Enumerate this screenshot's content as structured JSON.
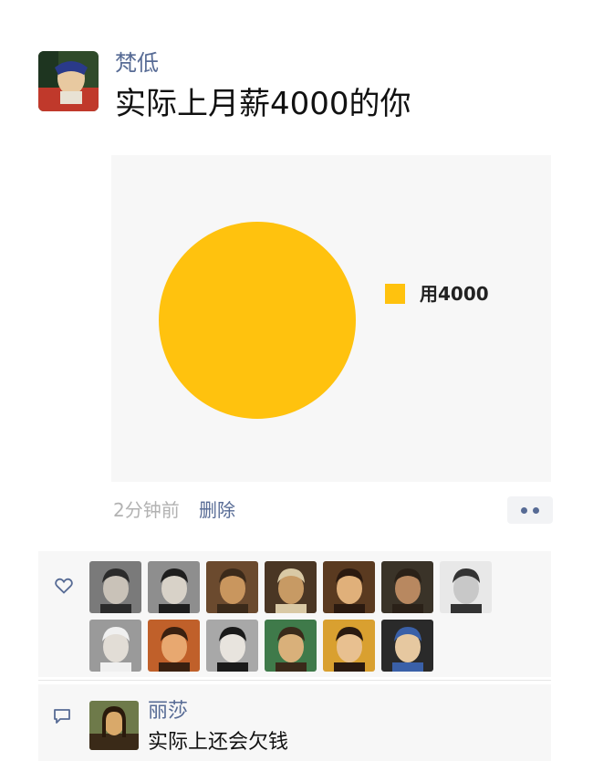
{
  "post": {
    "username": "梵低",
    "text": "实际上月薪4000的你",
    "time": "2分钟前",
    "delete_label": "删除"
  },
  "chart_data": {
    "type": "pie",
    "slices": [
      {
        "label": "用4000",
        "value": 4000,
        "color": "#ffc20e"
      }
    ],
    "legend_position": "right"
  },
  "likes": {
    "icon": "heart-outline-icon",
    "avatars": [
      {
        "name": "avatar-1",
        "bg": "#7a7a7a",
        "face": "#c9c2b8",
        "hair": "#2b2b2b"
      },
      {
        "name": "avatar-2",
        "bg": "#8e8e8e",
        "face": "#d8d2c8",
        "hair": "#1e1e1e"
      },
      {
        "name": "avatar-3",
        "bg": "#6b4a2e",
        "face": "#c9965e",
        "hair": "#3b2a1a"
      },
      {
        "name": "avatar-4",
        "bg": "#4a3624",
        "face": "#c79a64",
        "hair": "#d9c9a5"
      },
      {
        "name": "avatar-5",
        "bg": "#5a3a20",
        "face": "#e0b07a",
        "hair": "#2b1a10"
      },
      {
        "name": "avatar-6",
        "bg": "#3a3328",
        "face": "#b88860",
        "hair": "#2a2118"
      },
      {
        "name": "avatar-7",
        "bg": "#e8e8e8",
        "face": "#c8c8c8",
        "hair": "#333333"
      },
      {
        "name": "avatar-8",
        "bg": "#9a9a9a",
        "face": "#e2ddd6",
        "hair": "#f0f0f0"
      },
      {
        "name": "avatar-9",
        "bg": "#c0602a",
        "face": "#e8a870",
        "hair": "#3a2010"
      },
      {
        "name": "avatar-10",
        "bg": "#a8a8a8",
        "face": "#e8e4de",
        "hair": "#1a1a1a"
      },
      {
        "name": "avatar-11",
        "bg": "#3f7a4a",
        "face": "#d9b07a",
        "hair": "#3a2a1a"
      },
      {
        "name": "avatar-12",
        "bg": "#d9a030",
        "face": "#e8c090",
        "hair": "#2a1a10"
      },
      {
        "name": "avatar-13",
        "bg": "#2a2a2a",
        "face": "#e6c8a0",
        "hair": "#3a60a8"
      }
    ]
  },
  "comment": {
    "icon": "comment-icon",
    "author": "丽莎",
    "text": "实际上还会欠钱"
  }
}
